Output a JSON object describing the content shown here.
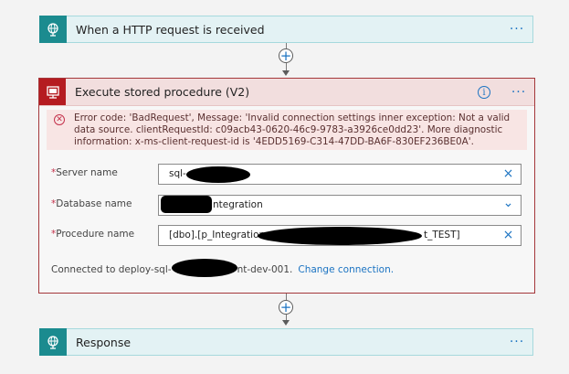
{
  "trigger": {
    "title": "When a HTTP request is received",
    "icon": "globe-icon",
    "more": "···"
  },
  "sql_action": {
    "title": "Execute stored procedure (V2)",
    "icon": "sql-server-icon",
    "info": "i",
    "more": "···",
    "error_icon": "✕",
    "error_message": "Error code: 'BadRequest', Message: 'Invalid connection settings inner exception: Not a valid data source. clientRequestId: c09acb43-0620-46c9-9783-a3926ce0dd23'. More diagnostic information: x-ms-client-request-id is '4EDD5169-C314-47DD-BA6F-830EF236BE0A'.",
    "fields": [
      {
        "label": "Server name",
        "required": "*",
        "value": "sql-",
        "action_icon": "×"
      },
      {
        "label": "Database name",
        "required": "*",
        "value": "ntegration",
        "action_icon": "⌄"
      },
      {
        "label": "Procedure name",
        "required": "*",
        "value": "[dbo].[p_Integration",
        "value_tail": "t_TEST]",
        "action_icon": "×"
      }
    ],
    "connection": {
      "prefix": "Connected to deploy-sql-",
      "suffix": "nt-dev-001.",
      "change_link": "Change connection."
    }
  },
  "connectors": {
    "plus": "+"
  },
  "response": {
    "title": "Response",
    "icon": "globe-icon",
    "more": "···"
  },
  "colors": {
    "trigger_bg": "#e3f2f4",
    "trigger_icon": "#1b8b8f",
    "error_border": "#a4373a",
    "error_header_bg": "#f2dede",
    "sql_icon": "#b51c21",
    "link": "#1b73c2"
  }
}
